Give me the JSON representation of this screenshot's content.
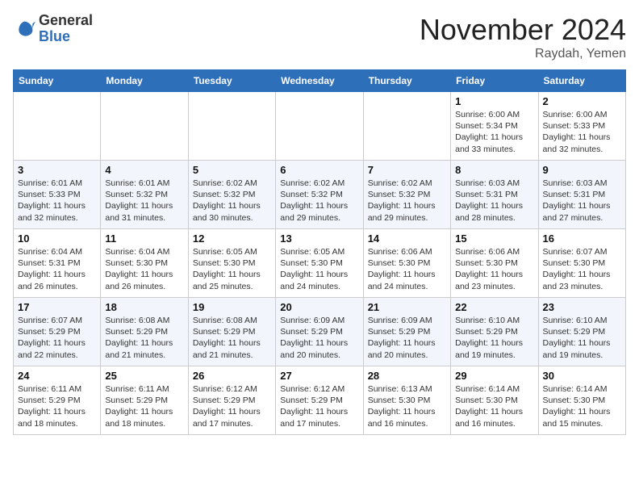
{
  "logo": {
    "general": "General",
    "blue": "Blue"
  },
  "title": "November 2024",
  "location": "Raydah, Yemen",
  "days_of_week": [
    "Sunday",
    "Monday",
    "Tuesday",
    "Wednesday",
    "Thursday",
    "Friday",
    "Saturday"
  ],
  "weeks": [
    [
      {
        "day": "",
        "info": ""
      },
      {
        "day": "",
        "info": ""
      },
      {
        "day": "",
        "info": ""
      },
      {
        "day": "",
        "info": ""
      },
      {
        "day": "",
        "info": ""
      },
      {
        "day": "1",
        "info": "Sunrise: 6:00 AM\nSunset: 5:34 PM\nDaylight: 11 hours\nand 33 minutes."
      },
      {
        "day": "2",
        "info": "Sunrise: 6:00 AM\nSunset: 5:33 PM\nDaylight: 11 hours\nand 32 minutes."
      }
    ],
    [
      {
        "day": "3",
        "info": "Sunrise: 6:01 AM\nSunset: 5:33 PM\nDaylight: 11 hours\nand 32 minutes."
      },
      {
        "day": "4",
        "info": "Sunrise: 6:01 AM\nSunset: 5:32 PM\nDaylight: 11 hours\nand 31 minutes."
      },
      {
        "day": "5",
        "info": "Sunrise: 6:02 AM\nSunset: 5:32 PM\nDaylight: 11 hours\nand 30 minutes."
      },
      {
        "day": "6",
        "info": "Sunrise: 6:02 AM\nSunset: 5:32 PM\nDaylight: 11 hours\nand 29 minutes."
      },
      {
        "day": "7",
        "info": "Sunrise: 6:02 AM\nSunset: 5:32 PM\nDaylight: 11 hours\nand 29 minutes."
      },
      {
        "day": "8",
        "info": "Sunrise: 6:03 AM\nSunset: 5:31 PM\nDaylight: 11 hours\nand 28 minutes."
      },
      {
        "day": "9",
        "info": "Sunrise: 6:03 AM\nSunset: 5:31 PM\nDaylight: 11 hours\nand 27 minutes."
      }
    ],
    [
      {
        "day": "10",
        "info": "Sunrise: 6:04 AM\nSunset: 5:31 PM\nDaylight: 11 hours\nand 26 minutes."
      },
      {
        "day": "11",
        "info": "Sunrise: 6:04 AM\nSunset: 5:30 PM\nDaylight: 11 hours\nand 26 minutes."
      },
      {
        "day": "12",
        "info": "Sunrise: 6:05 AM\nSunset: 5:30 PM\nDaylight: 11 hours\nand 25 minutes."
      },
      {
        "day": "13",
        "info": "Sunrise: 6:05 AM\nSunset: 5:30 PM\nDaylight: 11 hours\nand 24 minutes."
      },
      {
        "day": "14",
        "info": "Sunrise: 6:06 AM\nSunset: 5:30 PM\nDaylight: 11 hours\nand 24 minutes."
      },
      {
        "day": "15",
        "info": "Sunrise: 6:06 AM\nSunset: 5:30 PM\nDaylight: 11 hours\nand 23 minutes."
      },
      {
        "day": "16",
        "info": "Sunrise: 6:07 AM\nSunset: 5:30 PM\nDaylight: 11 hours\nand 23 minutes."
      }
    ],
    [
      {
        "day": "17",
        "info": "Sunrise: 6:07 AM\nSunset: 5:29 PM\nDaylight: 11 hours\nand 22 minutes."
      },
      {
        "day": "18",
        "info": "Sunrise: 6:08 AM\nSunset: 5:29 PM\nDaylight: 11 hours\nand 21 minutes."
      },
      {
        "day": "19",
        "info": "Sunrise: 6:08 AM\nSunset: 5:29 PM\nDaylight: 11 hours\nand 21 minutes."
      },
      {
        "day": "20",
        "info": "Sunrise: 6:09 AM\nSunset: 5:29 PM\nDaylight: 11 hours\nand 20 minutes."
      },
      {
        "day": "21",
        "info": "Sunrise: 6:09 AM\nSunset: 5:29 PM\nDaylight: 11 hours\nand 20 minutes."
      },
      {
        "day": "22",
        "info": "Sunrise: 6:10 AM\nSunset: 5:29 PM\nDaylight: 11 hours\nand 19 minutes."
      },
      {
        "day": "23",
        "info": "Sunrise: 6:10 AM\nSunset: 5:29 PM\nDaylight: 11 hours\nand 19 minutes."
      }
    ],
    [
      {
        "day": "24",
        "info": "Sunrise: 6:11 AM\nSunset: 5:29 PM\nDaylight: 11 hours\nand 18 minutes."
      },
      {
        "day": "25",
        "info": "Sunrise: 6:11 AM\nSunset: 5:29 PM\nDaylight: 11 hours\nand 18 minutes."
      },
      {
        "day": "26",
        "info": "Sunrise: 6:12 AM\nSunset: 5:29 PM\nDaylight: 11 hours\nand 17 minutes."
      },
      {
        "day": "27",
        "info": "Sunrise: 6:12 AM\nSunset: 5:29 PM\nDaylight: 11 hours\nand 17 minutes."
      },
      {
        "day": "28",
        "info": "Sunrise: 6:13 AM\nSunset: 5:30 PM\nDaylight: 11 hours\nand 16 minutes."
      },
      {
        "day": "29",
        "info": "Sunrise: 6:14 AM\nSunset: 5:30 PM\nDaylight: 11 hours\nand 16 minutes."
      },
      {
        "day": "30",
        "info": "Sunrise: 6:14 AM\nSunset: 5:30 PM\nDaylight: 11 hours\nand 15 minutes."
      }
    ]
  ]
}
